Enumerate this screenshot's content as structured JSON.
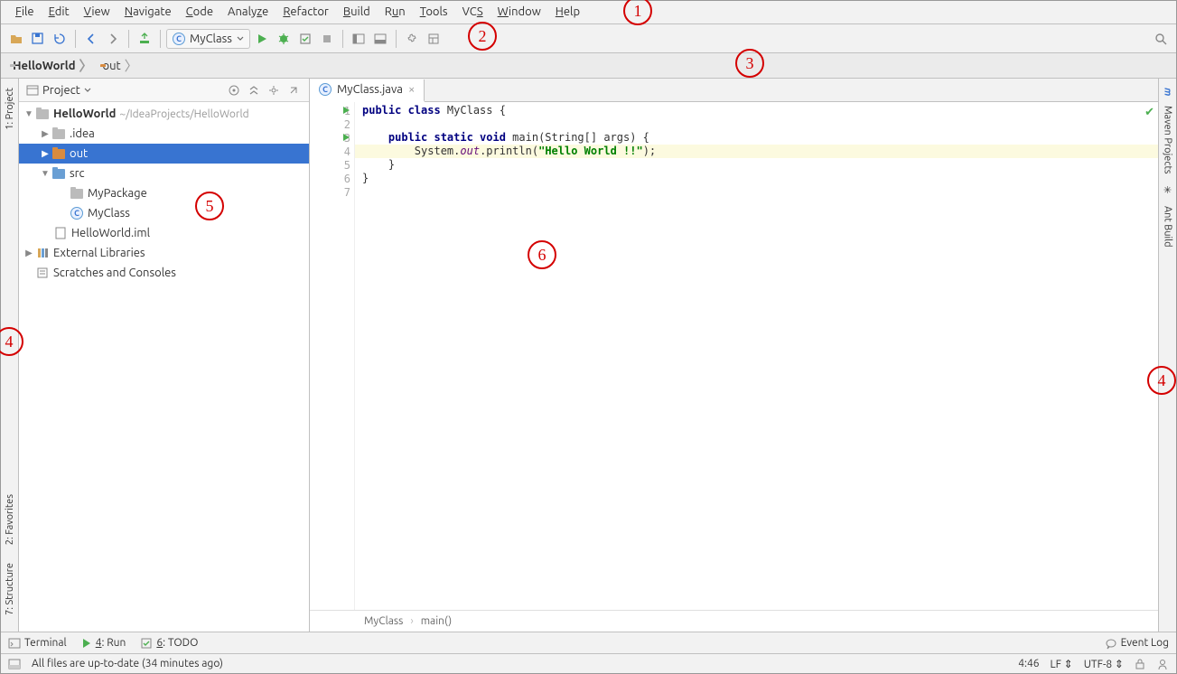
{
  "menubar": [
    "File",
    "Edit",
    "View",
    "Navigate",
    "Code",
    "Analyze",
    "Refactor",
    "Build",
    "Run",
    "Tools",
    "VCS",
    "Window",
    "Help"
  ],
  "toolbar": {
    "run_config": "MyClass"
  },
  "navbar": {
    "crumbs": [
      {
        "label": "HelloWorld",
        "bold": true,
        "icon": "folder-grey"
      },
      {
        "label": "out",
        "bold": false,
        "icon": "folder-orange"
      }
    ]
  },
  "project_panel": {
    "title": "Project"
  },
  "tree": {
    "root": {
      "label": "HelloWorld",
      "hint": "~/IdeaProjects/HelloWorld"
    },
    "children": [
      {
        "label": ".idea",
        "icon": "folder-grey",
        "depth": 1,
        "arrow": "right"
      },
      {
        "label": "out",
        "icon": "folder-orange",
        "depth": 1,
        "arrow": "right",
        "selected": true
      },
      {
        "label": "src",
        "icon": "folder-blue",
        "depth": 1,
        "arrow": "down"
      },
      {
        "label": "MyPackage",
        "icon": "folder-grey",
        "depth": 2,
        "arrow": ""
      },
      {
        "label": "MyClass",
        "icon": "java",
        "depth": 2,
        "arrow": ""
      },
      {
        "label": "HelloWorld.iml",
        "icon": "iml",
        "depth": 1,
        "arrow": ""
      }
    ],
    "ext_lib": "External Libraries",
    "scratches": "Scratches and Consoles"
  },
  "editor": {
    "tab": "MyClass.java",
    "lines": [
      {
        "n": 1,
        "mark": "run",
        "html": "<span class='kw'>public class</span> MyClass {"
      },
      {
        "n": 2,
        "mark": "",
        "html": ""
      },
      {
        "n": 3,
        "mark": "run",
        "html": "    <span class='kw'>public static void</span> main(String[] args) {"
      },
      {
        "n": 4,
        "mark": "",
        "html": "        System.<span class='field'>out</span>.println(<span class='str'>\"Hello World !!\"</span>);",
        "hl": true
      },
      {
        "n": 5,
        "mark": "",
        "html": "    }"
      },
      {
        "n": 6,
        "mark": "",
        "html": "}"
      },
      {
        "n": 7,
        "mark": "",
        "html": ""
      }
    ],
    "breadcrumb": [
      "MyClass",
      "main()"
    ]
  },
  "left_tools": [
    "1: Project",
    "2: Favorites",
    "7: Structure"
  ],
  "right_tools": [
    "Maven Projects",
    "Ant Build"
  ],
  "bottom_tools": {
    "terminal": "Terminal",
    "run": "4: Run",
    "todo": "6: TODO",
    "eventlog": "Event Log"
  },
  "status": {
    "msg": "All files are up-to-date (34 minutes ago)",
    "pos": "4:46",
    "le": "LF",
    "enc": "UTF-8"
  },
  "annotations": {
    "1": "1",
    "2": "2",
    "3": "3",
    "4": "4",
    "5": "5",
    "6": "6"
  }
}
